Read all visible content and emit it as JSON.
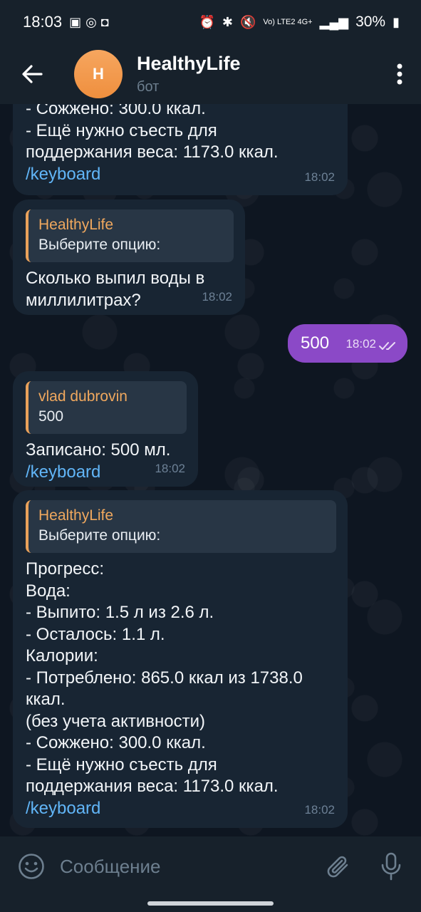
{
  "status_bar": {
    "time": "18:03",
    "battery": "30%",
    "signal_text": "Vo) LTE2 4G+"
  },
  "header": {
    "avatar_letter": "H",
    "title": "HealthyLife",
    "subtitle": "бот"
  },
  "messages": [
    {
      "lines": [
        "- Сожжено: 300.0 ккал.",
        "- Ещё нужно съесть для",
        "поддержания веса: 1173.0 ккал."
      ],
      "link": "/keyboard",
      "time": "18:02"
    },
    {
      "reply_name": "HealthyLife",
      "reply_text": "Выберите опцию:",
      "lines": [
        "Сколько выпил воды в",
        "миллилитрах?"
      ],
      "time": "18:02"
    },
    {
      "outgoing": true,
      "text": "500",
      "time": "18:02"
    },
    {
      "reply_name": "vlad dubrovin",
      "reply_text": "500",
      "lines": [
        "Записано: 500 мл."
      ],
      "link": "/keyboard",
      "time": "18:02"
    },
    {
      "reply_name": "HealthyLife",
      "reply_text": "Выберите опцию:",
      "lines": [
        "Прогресс:",
        "Вода:",
        "- Выпито: 1.5 л из 2.6 л.",
        "- Осталось: 1.1 л.",
        "Калории:",
        "- Потреблено: 865.0 ккал из 1738.0",
        "ккал.",
        "(без учета активности)",
        "- Сожжено: 300.0 ккал.",
        "- Ещё нужно съесть для",
        "поддержания веса: 1173.0 ккал."
      ],
      "link": "/keyboard",
      "time": "18:02"
    }
  ],
  "composer": {
    "placeholder": "Сообщение"
  },
  "colors": {
    "outgoing_bubble": "#8b49c7",
    "incoming_bubble": "#182533",
    "link": "#61b5f7",
    "reply_name": "#f0a85e",
    "avatar": "#ef8f3e"
  },
  "icons": {
    "back": "arrow-left-icon",
    "menu": "more-vertical-icon",
    "emoji": "smile-icon",
    "attach": "paperclip-icon",
    "mic": "microphone-icon",
    "read": "double-check-icon"
  }
}
